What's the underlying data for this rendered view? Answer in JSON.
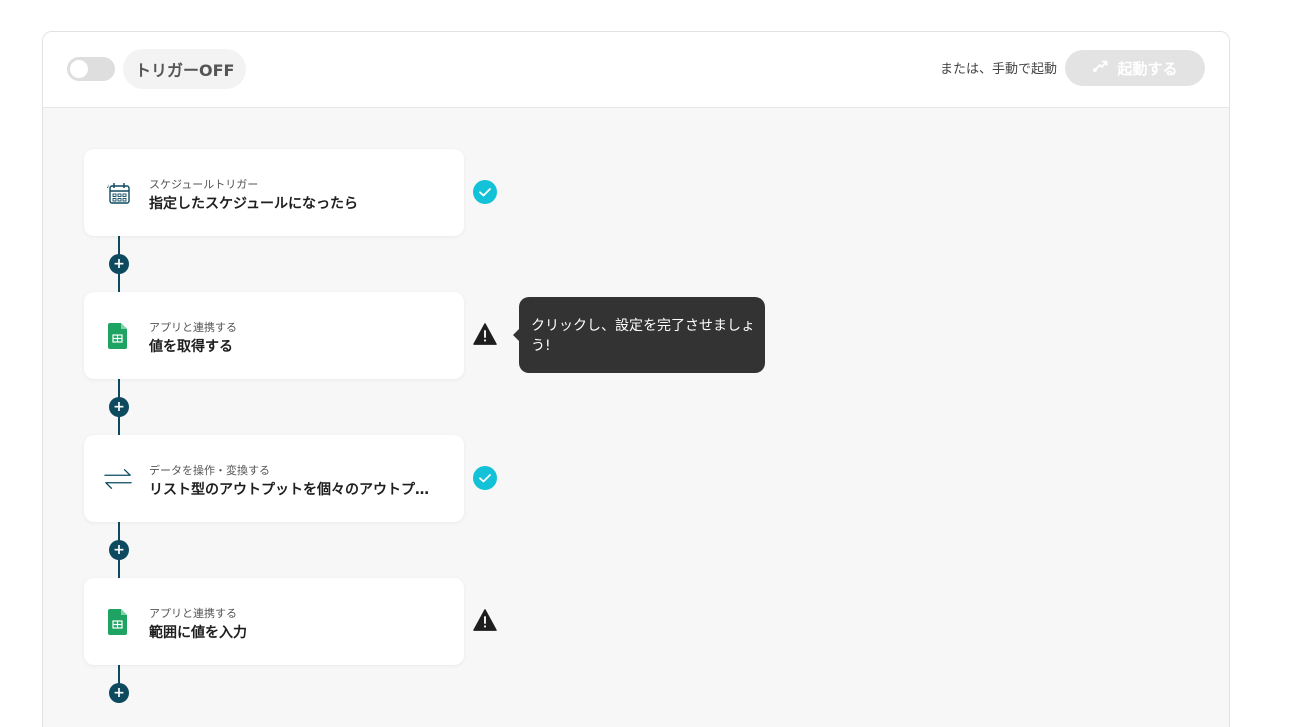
{
  "header": {
    "trigger_label": "トリガーOFF",
    "manual_label": "または、手動で起動",
    "start_button": "起動する"
  },
  "steps": [
    {
      "subtitle": "スケジュールトリガー",
      "title": "指定したスケジュールになったら",
      "icon": "calendar-schedule-icon",
      "status": "complete"
    },
    {
      "subtitle": "アプリと連携する",
      "title": "値を取得する",
      "icon": "google-sheets-icon",
      "status": "warning"
    },
    {
      "subtitle": "データを操作・変換する",
      "title": "リスト型のアウトプットを個々のアウトプットに変換する",
      "icon": "transform-arrows-icon",
      "status": "complete"
    },
    {
      "subtitle": "アプリと連携する",
      "title": "範囲に値を入力",
      "icon": "google-sheets-icon",
      "status": "warning"
    }
  ],
  "tooltip": "クリックし、設定を完了させましょう!",
  "colors": {
    "connector": "#0d4a60",
    "check": "#13c2d6",
    "sheets_green": "#1ea362",
    "tooltip_bg": "#333333"
  }
}
